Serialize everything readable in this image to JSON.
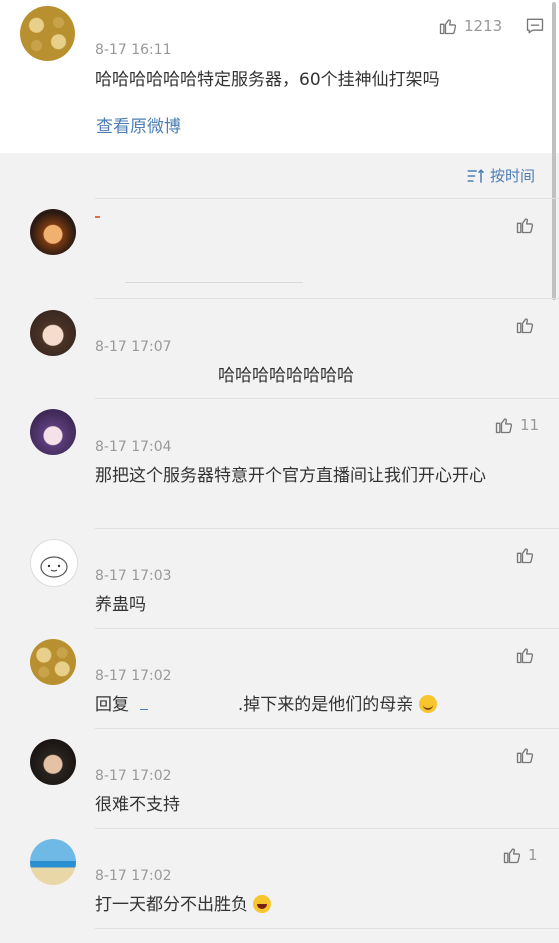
{
  "original_post": {
    "timestamp": "8-17 16:11",
    "text": "哈哈哈哈哈哈特定服务器，60个挂神仙打架吗",
    "like_count": "1213",
    "view_original_label": "查看原微博"
  },
  "sort": {
    "label": "按时间"
  },
  "comments": [
    {
      "username": "",
      "timestamp": "",
      "text": "",
      "like_count": ""
    },
    {
      "username": "",
      "timestamp": "8-17 17:07",
      "text": "哈哈哈哈哈哈哈哈",
      "like_count": ""
    },
    {
      "username": "",
      "timestamp": "8-17 17:04",
      "text": "那把这个服务器特意开个官方直播间让我们开心开心",
      "like_count": "11"
    },
    {
      "username": "",
      "timestamp": "8-17 17:03",
      "text": "养蛊吗",
      "like_count": ""
    },
    {
      "username": "",
      "timestamp": "8-17 17:02",
      "reply_prefix": "回复",
      "text": ".掉下来的是他们的母亲",
      "like_count": ""
    },
    {
      "username": "",
      "timestamp": "8-17 17:02",
      "text": "很难不支持",
      "like_count": ""
    },
    {
      "username": "",
      "timestamp": "8-17 17:02",
      "text": "打一天都分不出胜负",
      "like_count": "1"
    }
  ],
  "icons": {
    "like": "thumbs-up-icon",
    "comment": "comment-icon",
    "sort": "sort-icon",
    "smile_emoji": "smile-emoji-icon",
    "laugh_emoji": "laugh-emoji-icon"
  },
  "colors": {
    "link": "#4d7eb5",
    "text": "#333333",
    "meta": "#999999",
    "background": "#f2f2f2"
  }
}
